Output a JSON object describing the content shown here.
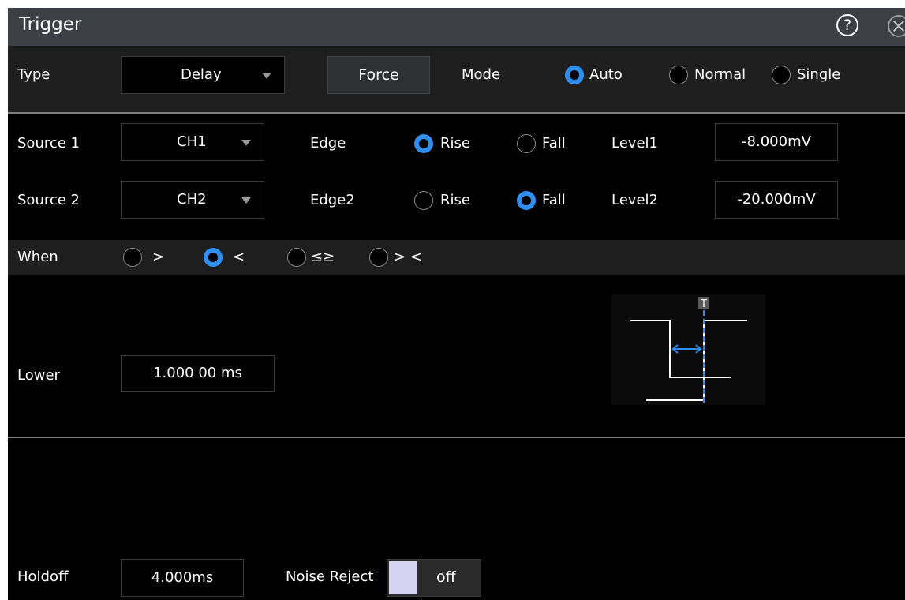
{
  "window": {
    "title": "Trigger",
    "help_symbol": "?"
  },
  "type_row": {
    "label": "Type",
    "type_value": "Delay",
    "force_label": "Force",
    "mode_label": "Mode",
    "modes": [
      {
        "label": "Auto",
        "selected": true
      },
      {
        "label": "Normal",
        "selected": false
      },
      {
        "label": "Single",
        "selected": false
      }
    ]
  },
  "source1": {
    "label": "Source 1",
    "value": "CH1",
    "edge_label": "Edge",
    "edges": [
      {
        "label": "Rise",
        "selected": true
      },
      {
        "label": "Fall",
        "selected": false
      }
    ],
    "level_label": "Level1",
    "level_value": "-8.000mV"
  },
  "source2": {
    "label": "Source 2",
    "value": "CH2",
    "edge_label": "Edge2",
    "edges": [
      {
        "label": "Rise",
        "selected": false
      },
      {
        "label": "Fall",
        "selected": true
      }
    ],
    "level_label": "Level2",
    "level_value": "-20.000mV"
  },
  "when": {
    "label": "When",
    "options": [
      {
        "label": ">",
        "selected": false
      },
      {
        "label": "<",
        "selected": true
      },
      {
        "label": "≤≥",
        "selected": false
      },
      {
        "label": "> <",
        "selected": false
      }
    ]
  },
  "lower": {
    "label": "Lower",
    "value": "1.000 00 ms"
  },
  "diagram": {
    "trigger_marker": "T",
    "accent_color": "#2f8ef0"
  },
  "holdoff": {
    "label": "Holdoff",
    "value": "4.000ms"
  },
  "noise_reject": {
    "label": "Noise Reject",
    "state": "off"
  },
  "colors": {
    "accent": "#2f8ef0",
    "title_bar": "#3c3f44",
    "row_highlight": "#1e1e1e"
  }
}
